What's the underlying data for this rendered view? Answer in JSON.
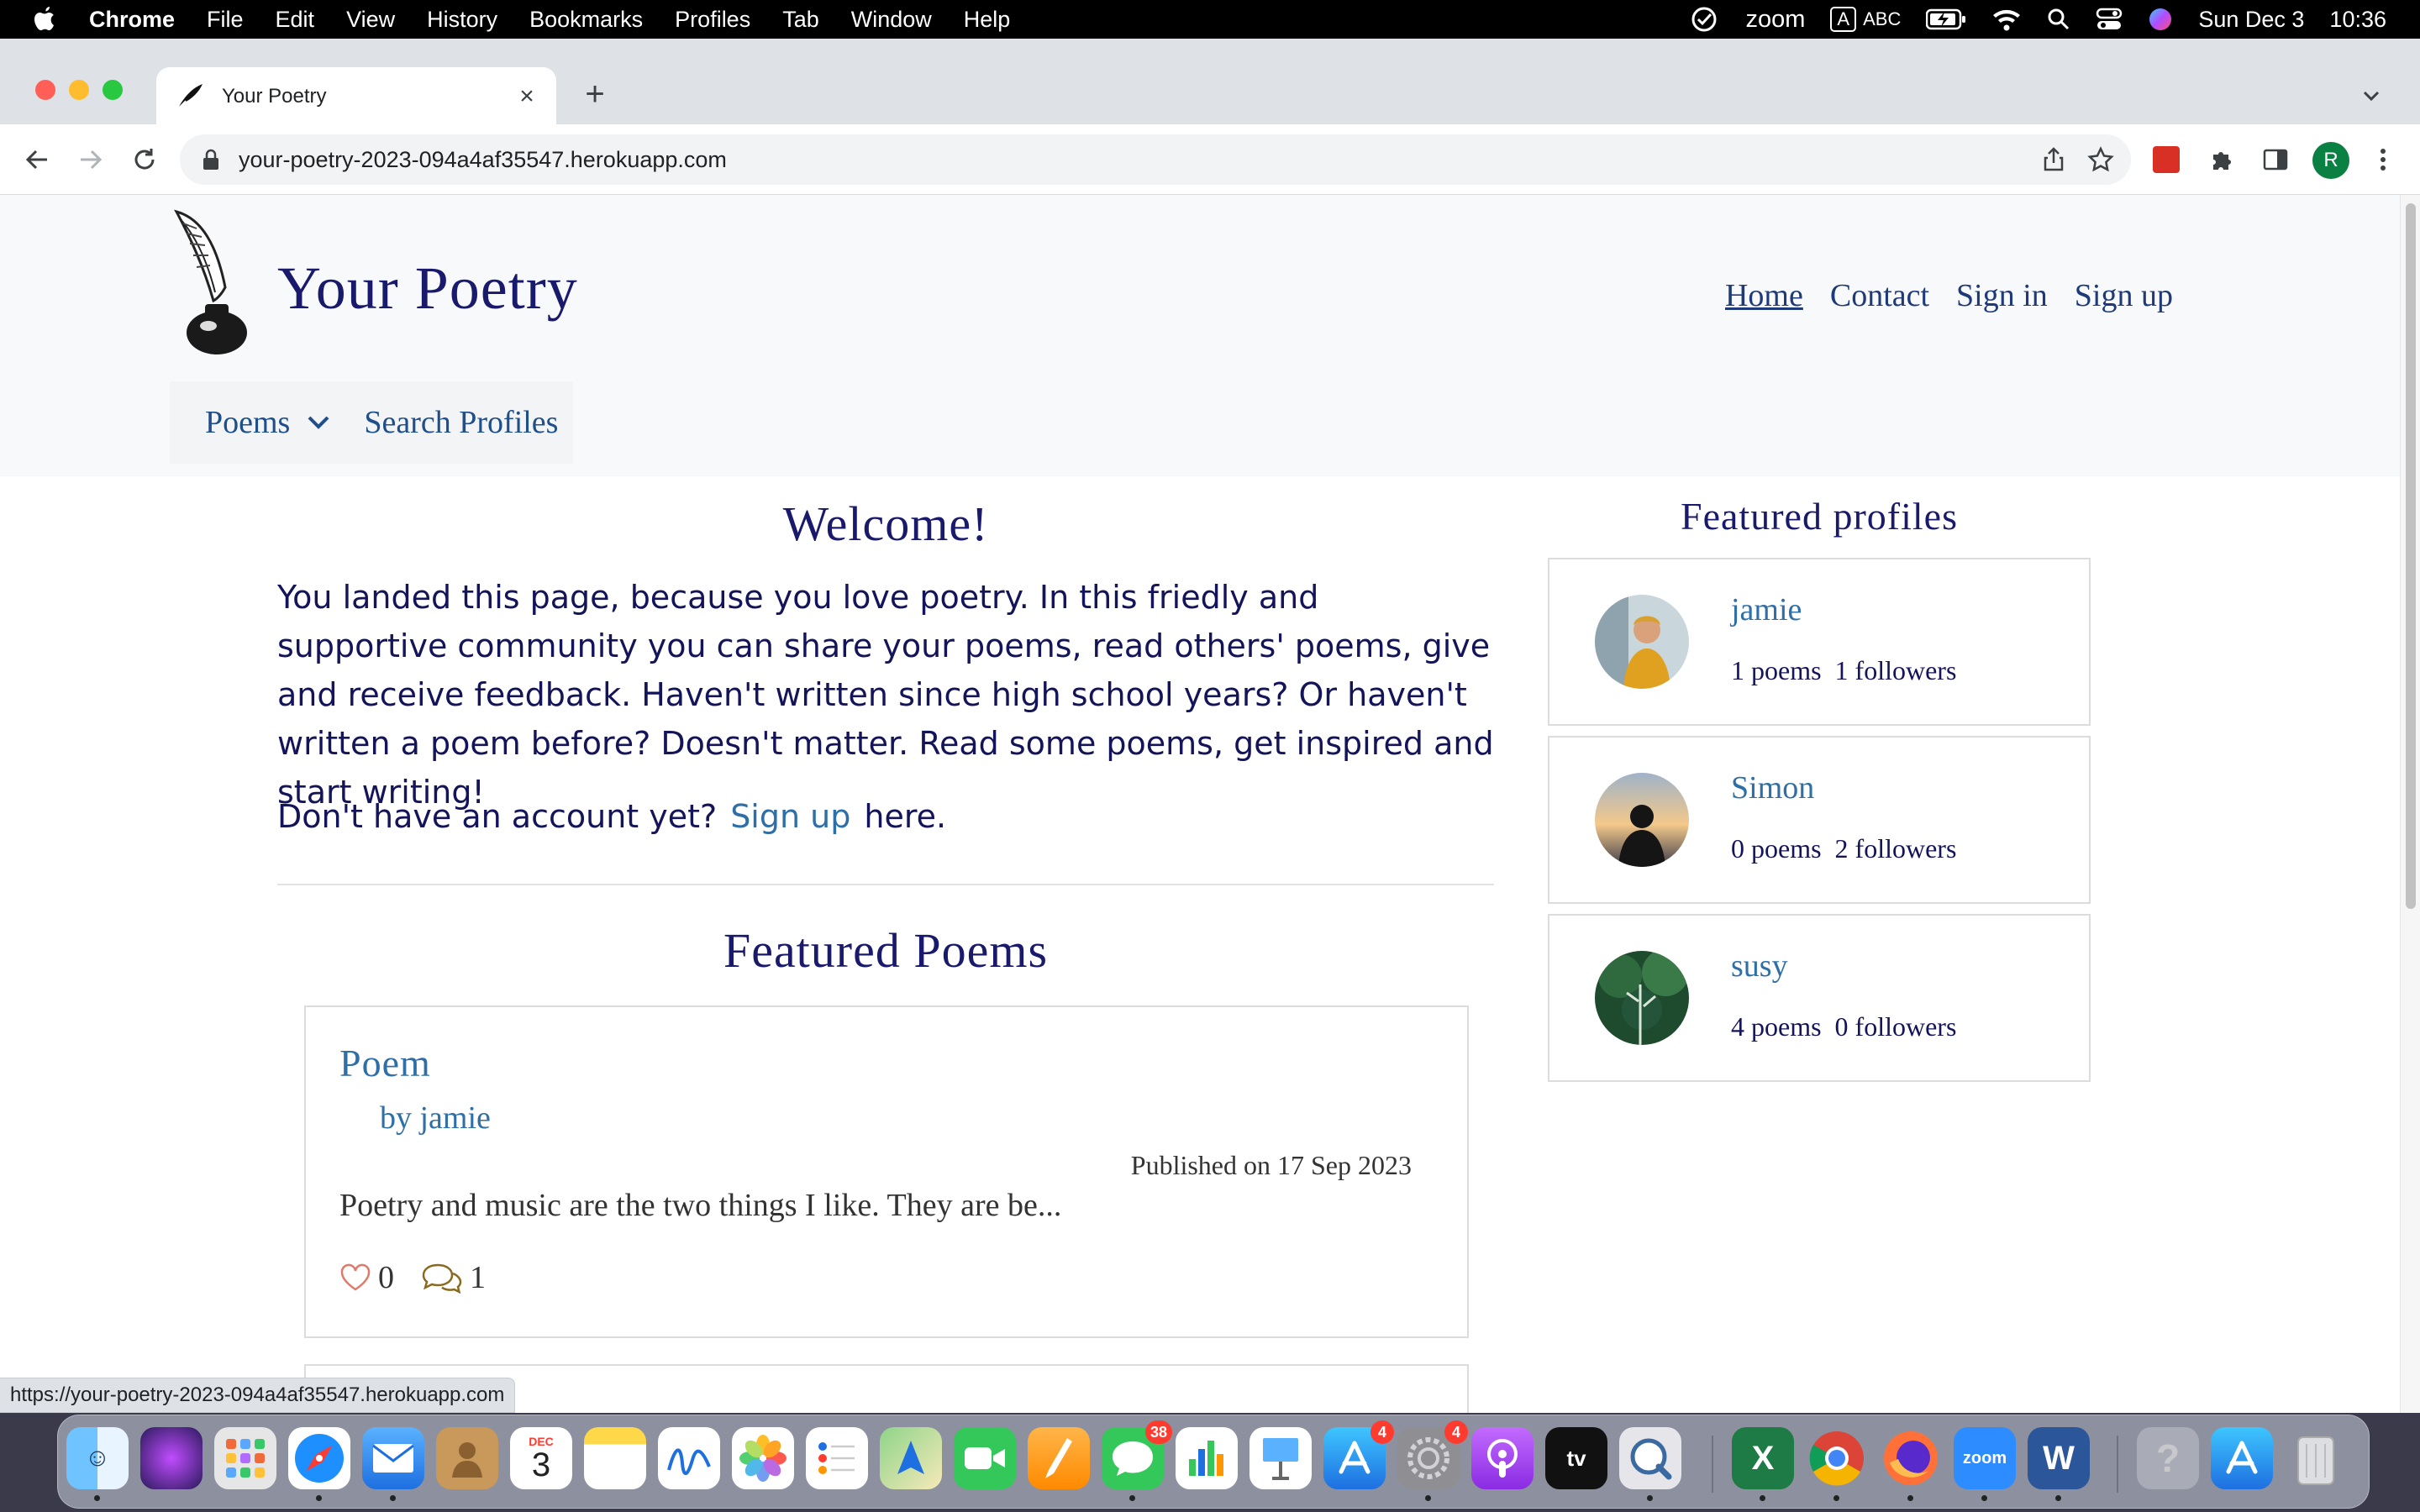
{
  "menubar": {
    "items": [
      "Chrome",
      "File",
      "Edit",
      "View",
      "History",
      "Bookmarks",
      "Profiles",
      "Tab",
      "Window",
      "Help"
    ],
    "status": {
      "zoom": "zoom",
      "input_badge": "A",
      "input_label": "ABC",
      "date": "Sun Dec 3",
      "time": "10:36"
    }
  },
  "browser": {
    "tab_title": "Your Poetry",
    "url": "your-poetry-2023-094a4af35547.herokuapp.com",
    "profile_initial": "R",
    "status_url": "https://your-poetry-2023-094a4af35547.herokuapp.com"
  },
  "site": {
    "brand": "Your Poetry",
    "nav": [
      "Home",
      "Contact",
      "Sign in",
      "Sign up"
    ],
    "subnav": {
      "poems": "Poems",
      "search": "Search Profiles"
    }
  },
  "welcome": {
    "title": "Welcome!",
    "text": "You landed this page, because you love poetry. In this friedly and supportive community you can share your poems, read others' poems, give and receive feedback. Haven't written since high school years? Or haven't written a poem before? Doesn't matter. Read some poems, get inspired and start writing!",
    "account_prefix": "Don't have an account yet?",
    "account_link": "Sign up",
    "account_suffix": "here."
  },
  "featured_poems": {
    "title": "Featured Poems",
    "items": [
      {
        "title": "Poem",
        "author": "by jamie",
        "published": "Published on 17 Sep 2023",
        "excerpt": "Poetry and music are the two things I like. They are be...",
        "likes": "0",
        "comments": "1"
      }
    ]
  },
  "featured_profiles": {
    "title": "Featured profiles",
    "items": [
      {
        "name": "jamie",
        "poems": "1 poems",
        "followers": "1 followers"
      },
      {
        "name": "Simon",
        "poems": "0 poems",
        "followers": "2 followers"
      },
      {
        "name": "susy",
        "poems": "4 poems",
        "followers": "0 followers"
      }
    ]
  },
  "dock": {
    "calendar": {
      "month": "DEC",
      "day": "3"
    },
    "messages_badge": "38",
    "appstore_badge": "4",
    "settings_badge": "4",
    "zoom_label": "zoom",
    "tv_label": "tv",
    "word_label": "W",
    "excel_label": "X",
    "help_label": "?"
  },
  "colors": {
    "brand_navy": "#1a1a6c",
    "link_blue": "#2e6fa8",
    "header_bg": "#f8f9fa",
    "like_heart": "#e07a6a",
    "comment_icon": "#8a6a20"
  }
}
